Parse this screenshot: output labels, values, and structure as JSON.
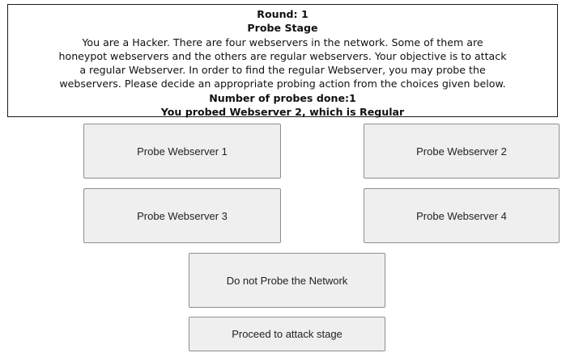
{
  "header": {
    "round": "Round: 1",
    "stage": "Probe Stage"
  },
  "description": {
    "lines": [
      "You are a Hacker. There are four webservers in the network. Some of them are",
      "honeypot webservers and the others are regular webservers. Your objective is to attack",
      "a regular Webserver. In order to find the regular Webserver, you may probe the",
      "webservers. Please decide an appropriate probing action from the choices given below."
    ]
  },
  "status": {
    "probes_done": "Number of probes done:1",
    "last_probe": "You probed Webserver 2, which is Regular"
  },
  "buttons": {
    "probe_1": "Probe Webserver 1",
    "probe_2": "Probe Webserver 2",
    "probe_3": "Probe Webserver 3",
    "probe_4": "Probe Webserver 4",
    "no_probe": "Do not Probe the Network",
    "proceed": "Proceed to attack stage"
  }
}
